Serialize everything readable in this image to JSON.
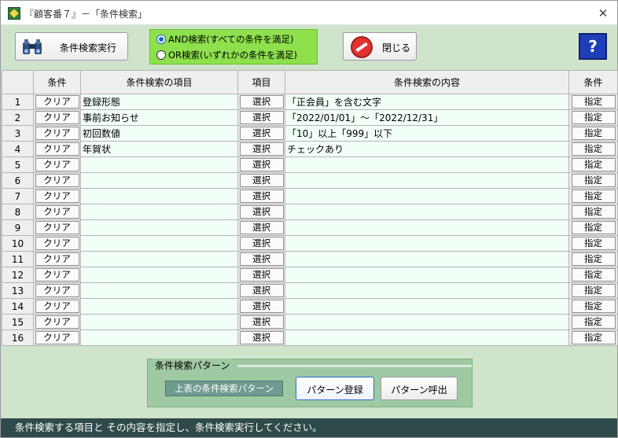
{
  "window": {
    "title": "『顧客番７』－「条件検索」",
    "close_glyph": "✕"
  },
  "toolbar": {
    "exec_label": "条件検索実行",
    "close_label": "閉じる",
    "help_glyph": "?"
  },
  "mode": {
    "options": [
      {
        "label": "AND検索(すべての条件を満足)",
        "selected": true
      },
      {
        "label": "OR検索(いずれかの条件を満足)",
        "selected": false
      }
    ]
  },
  "grid": {
    "headers": [
      "",
      "条件",
      "条件検索の項目",
      "項目",
      "条件検索の内容",
      "条件"
    ],
    "clear_label": "クリア",
    "select_label": "選択",
    "assign_label": "指定",
    "rows": [
      {
        "no": "1",
        "item": "登録形態",
        "content": "「正会員」を含む文字"
      },
      {
        "no": "2",
        "item": "事前お知らせ",
        "content": "「2022/01/01」～「2022/12/31」"
      },
      {
        "no": "3",
        "item": "初回数値",
        "content": "「10」以上「999」以下"
      },
      {
        "no": "4",
        "item": "年賀状",
        "content": "チェックあり"
      },
      {
        "no": "5",
        "item": "",
        "content": ""
      },
      {
        "no": "6",
        "item": "",
        "content": ""
      },
      {
        "no": "7",
        "item": "",
        "content": ""
      },
      {
        "no": "8",
        "item": "",
        "content": ""
      },
      {
        "no": "9",
        "item": "",
        "content": ""
      },
      {
        "no": "10",
        "item": "",
        "content": ""
      },
      {
        "no": "11",
        "item": "",
        "content": ""
      },
      {
        "no": "12",
        "item": "",
        "content": ""
      },
      {
        "no": "13",
        "item": "",
        "content": ""
      },
      {
        "no": "14",
        "item": "",
        "content": ""
      },
      {
        "no": "15",
        "item": "",
        "content": ""
      },
      {
        "no": "16",
        "item": "",
        "content": ""
      }
    ]
  },
  "pattern": {
    "legend": "条件検索パターン",
    "display_label": "上表の条件検索パターン",
    "register_label": "パターン登録",
    "call_label": "パターン呼出"
  },
  "status": {
    "message": "条件検索する項目と その内容を指定し、条件検索実行してください。"
  },
  "colors": {
    "background": "#cfe4cb",
    "radio_panel": "#8ee04d",
    "statusbar": "#2f4a4a"
  }
}
